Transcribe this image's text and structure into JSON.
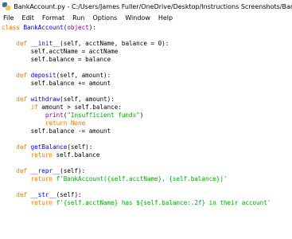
{
  "window": {
    "title": "BankAccount.py - C:/Users/James Fuller/OneDrive/Desktop/Instructions Screenshots/BankAcc...",
    "icon": "python-idle-icon"
  },
  "menu": [
    "File",
    "Edit",
    "Format",
    "Run",
    "Options",
    "Window",
    "Help"
  ],
  "colors": {
    "keyword": "#ff7700",
    "builtin": "#900090",
    "definition": "#0000ff",
    "string": "#00aa00",
    "text": "#000000"
  },
  "code": {
    "l1": {
      "a": "class",
      "b": " ",
      "c": "BankAccount",
      "d": "(",
      "e": "object",
      "f": "):"
    },
    "l3": {
      "a": "    ",
      "b": "def",
      "c": " ",
      "d": "__init__",
      "e": "(self, acctName, balance = 0):"
    },
    "l4": {
      "a": "        self.acctName = acctName"
    },
    "l5": {
      "a": "        self.balance = balance"
    },
    "l7": {
      "a": "    ",
      "b": "def",
      "c": " ",
      "d": "deposit",
      "e": "(self, amount):"
    },
    "l8": {
      "a": "        self.balance += amount"
    },
    "l10": {
      "a": "    ",
      "b": "def",
      "c": " ",
      "d": "withdraw",
      "e": "(self, amount):"
    },
    "l11": {
      "a": "        ",
      "b": "if",
      "c": " amount > self.balance:"
    },
    "l12": {
      "a": "            ",
      "b": "print",
      "c": "(",
      "d": "\"Insufficient funds\"",
      "e": ")"
    },
    "l13": {
      "a": "            ",
      "b": "return",
      "c": " ",
      "d": "None"
    },
    "l14": {
      "a": "        self.balance -= amount"
    },
    "l16": {
      "a": "    ",
      "b": "def",
      "c": " ",
      "d": "getBalance",
      "e": "(self):"
    },
    "l17": {
      "a": "        ",
      "b": "return",
      "c": " self.balance"
    },
    "l19": {
      "a": "    ",
      "b": "def",
      "c": " ",
      "d": "__repr__",
      "e": "(self):"
    },
    "l20": {
      "a": "        ",
      "b": "return",
      "c": " ",
      "d": "f'BankAccount({self.acctName}, {self.balance})'"
    },
    "l22": {
      "a": "    ",
      "b": "def",
      "c": " ",
      "d": "__str__",
      "e": "(self):"
    },
    "l23": {
      "a": "        ",
      "b": "return",
      "c": " ",
      "d": "f'{self.acctName} has ${self.balance:.2f} in their account'"
    }
  }
}
